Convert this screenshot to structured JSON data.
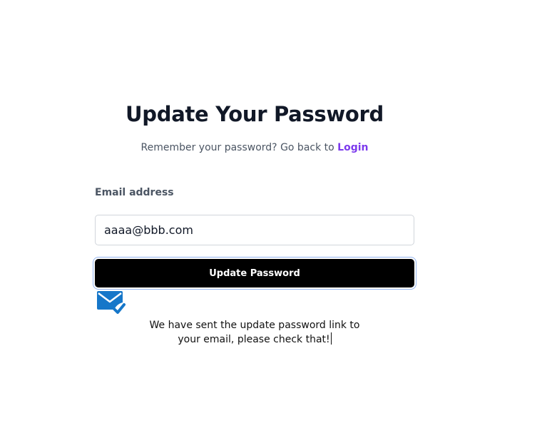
{
  "form": {
    "title": "Update Your Password",
    "subtitle_text": "Remember your password? Go back to ",
    "login_link": "Login",
    "email_label": "Email address",
    "email_value": "aaaa@bbb.com",
    "submit_label": "Update Password"
  },
  "confirmation": {
    "icon": "mail-check-icon",
    "line1": "We have sent the update password link to",
    "line2": "your email, please check that!"
  },
  "colors": {
    "heading": "#111827",
    "link": "#7c3aed",
    "button_bg": "#000000",
    "icon": "#1677c9"
  }
}
